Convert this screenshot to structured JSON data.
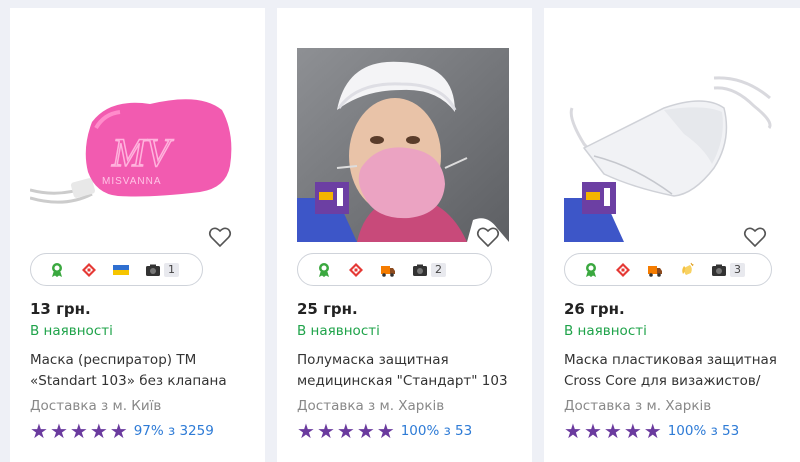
{
  "products": [
    {
      "image": "pink-respirator-mask-misvanna",
      "image_logo_text": "MISVANNA",
      "price": "13 грн.",
      "stock": "В наявності",
      "title": "Маска (респиратор) ТМ «Standart 103» без клапана",
      "delivery": "Доставка з м. Київ",
      "rating_stars": 5,
      "rating_text": "97% з 3259",
      "photo_count": "1",
      "badges": [
        "quality-ribbon-icon",
        "nova-poshta-icon",
        "ukraine-flag-icon",
        "camera-icon"
      ]
    },
    {
      "image": "woman-wearing-pink-half-mask",
      "price": "25 грн.",
      "stock": "В наявності",
      "title": "Полумаска защитная медицинская \"Стандарт\" 103",
      "delivery": "Доставка з м. Харків",
      "rating_stars": 5,
      "rating_text": "100% з 53",
      "photo_count": "2",
      "badges": [
        "quality-ribbon-icon",
        "nova-poshta-icon",
        "delivery-truck-icon",
        "camera-icon"
      ]
    },
    {
      "image": "clear-plastic-face-mask",
      "price": "26 грн.",
      "stock": "В наявності",
      "title": "Маска пластиковая защитная Cross Core для визажистов/",
      "delivery": "Доставка з м. Харків",
      "rating_stars": 5,
      "rating_text": "100% з 53",
      "photo_count": "3",
      "badges": [
        "quality-ribbon-icon",
        "nova-poshta-icon",
        "delivery-truck-icon",
        "clapping-hands-icon",
        "camera-icon"
      ]
    }
  ],
  "colors": {
    "stock_green": "#1fa34a",
    "star_purple": "#6a3a9e",
    "rating_link_blue": "#2e7bd6",
    "nova_poshta_red": "#e53935",
    "ribbon_green": "#3aa83f"
  }
}
